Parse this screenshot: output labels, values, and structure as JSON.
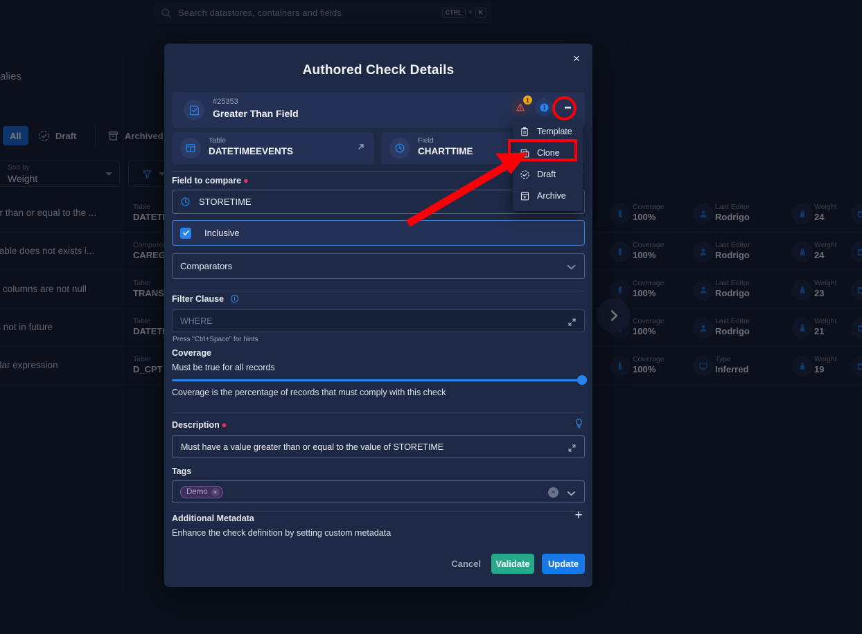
{
  "topbar": {
    "search": {
      "placeholder": "Search datastores, containers and fields",
      "kbd_ctrl": "CTRL",
      "kbd_plus": "+",
      "kbd_key": "K"
    }
  },
  "background": {
    "page_title": "alies",
    "tabs": [
      {
        "label": "All",
        "icon": "none"
      },
      {
        "label": "Draft",
        "icon": "draft-icon"
      },
      {
        "label": "Archived",
        "icon": "archive-icon"
      }
    ],
    "sort": {
      "label": "Sort by",
      "value": "Weight"
    },
    "rows": [
      {
        "description": "e greater than or equal to the ...",
        "table_label": "Table",
        "table_value": "DATETIM",
        "coverage_label": "Coverage",
        "coverage_value": "100%",
        "editor_label": "Last Editor",
        "editor_value": "Rodrigo",
        "weight_label": "Weight",
        "weight_value": "24"
      },
      {
        "description": "erence table does not exists i...",
        "table_label": "Computed",
        "table_value": "CAREGIV",
        "coverage_label": "Coverage",
        "coverage_value": "100%",
        "editor_label": "Last Editor",
        "editor_value": "Rodrigo",
        "weight_label": "Weight",
        "weight_value": "24"
      },
      {
        "description": "selected columns are not null",
        "table_label": "Table",
        "table_value": "TRANSFE",
        "coverage_label": "Coverage",
        "coverage_value": "100%",
        "editor_label": "Last Editor",
        "editor_value": "Rodrigo",
        "weight_label": "Weight",
        "weight_value": "23"
      },
      {
        "description": "retime is not in future",
        "table_label": "Table",
        "table_value": "DATETIM",
        "coverage_label": "Coverage",
        "coverage_value": "100%",
        "editor_label": "Last Editor",
        "editor_value": "Rodrigo",
        "weight_label": "Weight",
        "weight_value": "21"
      },
      {
        "description": "the regular expression",
        "table_label": "Table",
        "table_value": "D_CPT",
        "coverage_label": "Coverage",
        "coverage_value": "100%",
        "editor_label": "Type",
        "editor_value": "Inferred",
        "weight_label": "Weight",
        "weight_value": "19"
      }
    ]
  },
  "modal": {
    "title": "Authored Check Details",
    "close_label": "×",
    "header": {
      "id": "#25353",
      "name": "Greater Than Field",
      "warning_badge": "1"
    },
    "cards": [
      {
        "label": "Table",
        "value": "DATETIMEEVENTS",
        "icon": "table-icon"
      },
      {
        "label": "Field",
        "value": "CHARTTIME",
        "icon": "clock-icon"
      }
    ],
    "field_to_compare": {
      "label": "Field to compare",
      "required": true,
      "value": "STORETIME"
    },
    "inclusive": {
      "label": "Inclusive",
      "checked": true
    },
    "comparators": {
      "label": "Comparators"
    },
    "filter_clause": {
      "label": "Filter Clause",
      "placeholder": "WHERE",
      "hint": "Press \"Ctrl+Space\" for hints"
    },
    "coverage": {
      "label": "Coverage",
      "subtitle": "Must be true for all records",
      "note": "Coverage is the percentage of records that must comply with this check",
      "percent": 100
    },
    "description": {
      "label": "Description",
      "required": true,
      "value": "Must have a value greater than or equal to the value of STORETIME"
    },
    "tags": {
      "label": "Tags",
      "items": [
        {
          "name": "Demo"
        }
      ]
    },
    "additional_metadata": {
      "label": "Additional Metadata",
      "subtitle": "Enhance the check definition by setting custom metadata",
      "add_label": "+"
    },
    "footer": {
      "cancel": "Cancel",
      "validate": "Validate",
      "update": "Update"
    }
  },
  "menu": {
    "items": [
      {
        "label": "Template",
        "icon": "template-icon"
      },
      {
        "label": "Clone",
        "icon": "clone-icon"
      },
      {
        "label": "Draft",
        "icon": "draft-check-icon"
      },
      {
        "label": "Archive",
        "icon": "archive-box-icon"
      }
    ]
  },
  "colors": {
    "accent_blue": "#1779e8",
    "validate_green": "#27a98c",
    "highlight_red": "#fb0007",
    "warning_amber": "#e8a317",
    "tag_purple": "#c09ce8",
    "modal_bg": "#1e2945",
    "page_bg": "#101726"
  }
}
